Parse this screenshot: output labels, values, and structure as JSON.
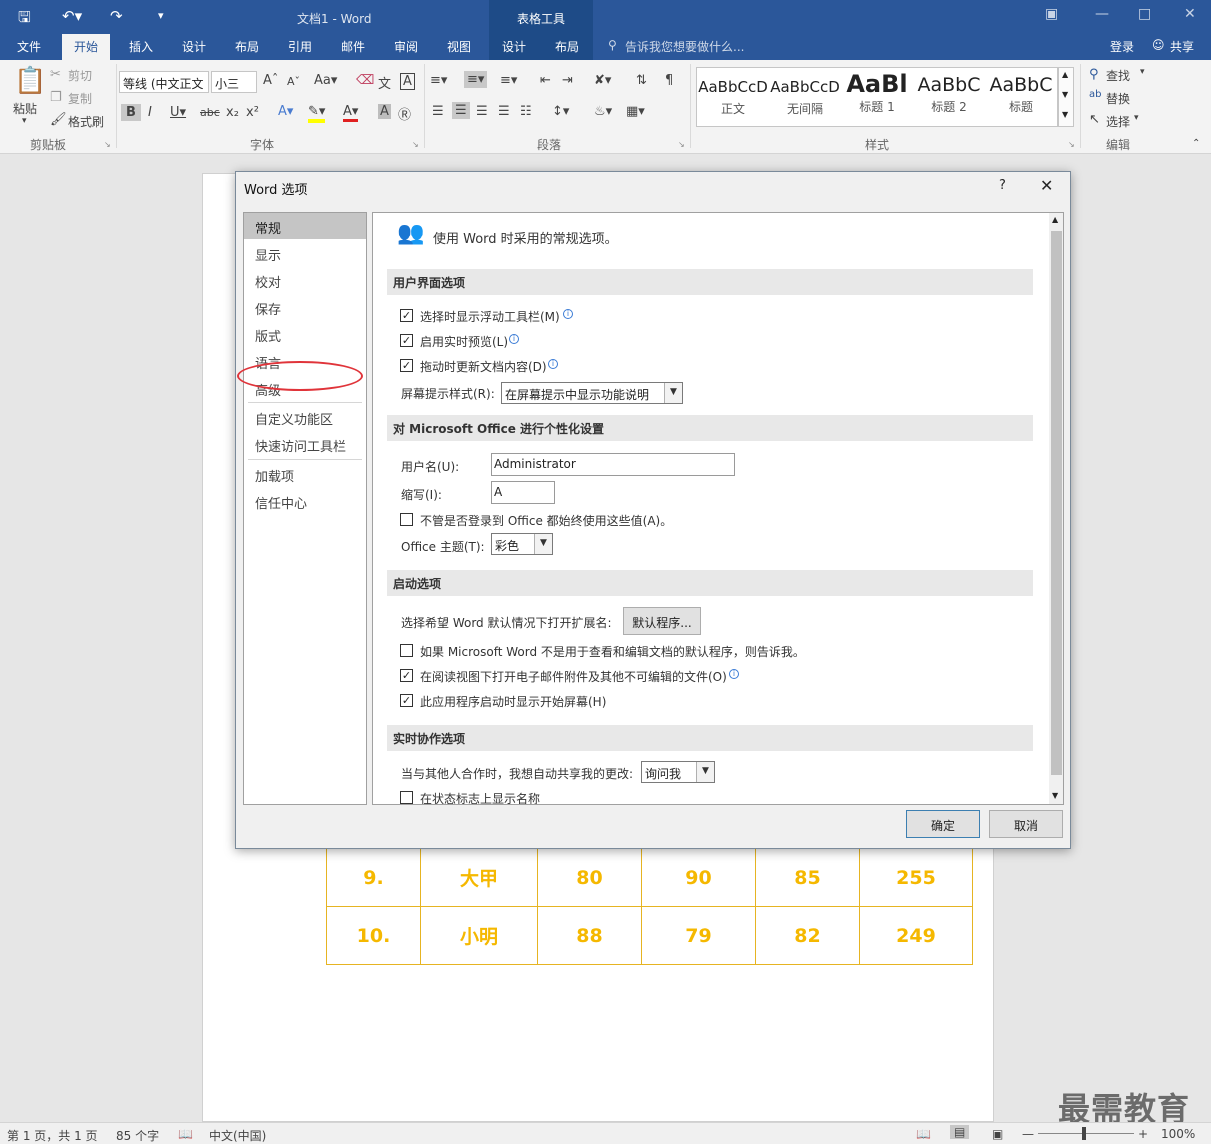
{
  "window": {
    "title": "文档1 - Word",
    "context_tab_header": "表格工具",
    "login": "登录",
    "share": "共享"
  },
  "tabs": [
    "文件",
    "开始",
    "插入",
    "设计",
    "布局",
    "引用",
    "邮件",
    "审阅",
    "视图",
    "设计",
    "布局"
  ],
  "tell_me": "告诉我您想要做什么...",
  "ribbon": {
    "clipboard": {
      "paste": "粘贴",
      "cut": "剪切",
      "copy": "复制",
      "format_painter": "格式刷",
      "group": "剪贴板"
    },
    "font": {
      "name": "等线 (中文正文",
      "size": "小三",
      "group": "字体"
    },
    "paragraph": {
      "group": "段落"
    },
    "styles": {
      "items": [
        {
          "sample": "AaBbCcD",
          "name": "正文"
        },
        {
          "sample": "AaBbCcD",
          "name": "无间隔"
        },
        {
          "sample": "AaBl",
          "name": "标题 1"
        },
        {
          "sample": "AaBbC",
          "name": "标题 2"
        },
        {
          "sample": "AaBbC",
          "name": "标题"
        }
      ],
      "group": "样式"
    },
    "editing": {
      "find": "查找",
      "replace": "替换",
      "select": "选择",
      "group": "编辑"
    }
  },
  "table": {
    "rows": [
      [
        "9.",
        "大甲",
        "80",
        "90",
        "85",
        "255"
      ],
      [
        "10.",
        "小明",
        "88",
        "79",
        "82",
        "249"
      ]
    ]
  },
  "watermark": "最需教育",
  "status": {
    "page": "第 1 页，共 1 页",
    "words": "85 个字",
    "language": "中文(中国)",
    "zoom": "100%"
  },
  "dialog": {
    "title": "Word 选项",
    "help": "?",
    "nav": [
      "常规",
      "显示",
      "校对",
      "保存",
      "版式",
      "语言",
      "高级",
      "自定义功能区",
      "快速访问工具栏",
      "加载项",
      "信任中心"
    ],
    "header": "使用 Word 时采用的常规选项。",
    "sections": {
      "ui": "用户界面选项",
      "personalize": "对 Microsoft Office 进行个性化设置",
      "startup": "启动选项",
      "collab": "实时协作选项"
    },
    "options": {
      "mini_toolbar": "选择时显示浮动工具栏(M)",
      "live_preview": "启用实时预览(L)",
      "update_drag": "拖动时更新文档内容(D)",
      "screentip_label": "屏幕提示样式(R):",
      "screentip_value": "在屏幕提示中显示功能说明",
      "username_label": "用户名(U):",
      "username_value": "Administrator",
      "initials_label": "缩写(I):",
      "initials_value": "A",
      "always_use": "不管是否登录到 Office 都始终使用这些值(A)。",
      "theme_label": "Office 主题(T):",
      "theme_value": "彩色",
      "ext_label": "选择希望 Word 默认情况下打开扩展名:",
      "default_programs": "默认程序...",
      "tell_default": "如果 Microsoft Word 不是用于查看和编辑文档的默认程序，则告诉我。",
      "open_reading": "在阅读视图下打开电子邮件附件及其他不可编辑的文件(O)",
      "show_start": "此应用程序启动时显示开始屏幕(H)",
      "share_label": "当与其他人合作时，我想自动共享我的更改:",
      "share_value": "询问我",
      "show_names": "在状态标志上显示名称"
    },
    "ok": "确定",
    "cancel": "取消"
  }
}
